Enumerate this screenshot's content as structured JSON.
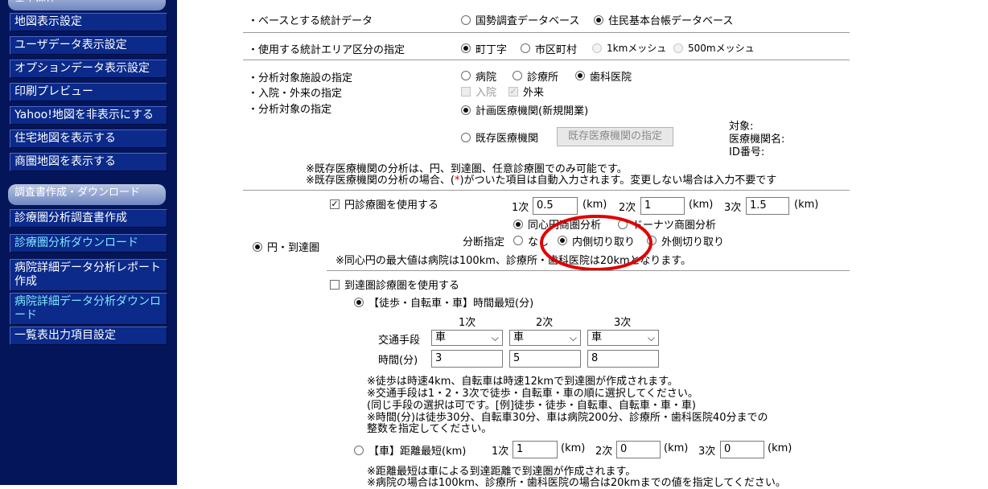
{
  "sidebar": {
    "section1": "基本操作",
    "items1": [
      "地図表示設定",
      "ユーザデータ表示設定",
      "オプションデータ表示設定",
      "印刷プレビュー",
      "Yahoo!地図を非表示にする",
      "住宅地図を表示する",
      "商圏地図を表示する"
    ],
    "section2": "調査書作成・ダウンロード",
    "items2": [
      "診療圏分析調査書作成",
      "診療圏分析ダウンロード",
      "病院詳細データ分析レポート作成",
      "病院詳細データ分析ダウンロード",
      "一覧表出力項目設定"
    ]
  },
  "base": {
    "label": "・ベースとする統計データ",
    "opt1": "国勢調査データベース",
    "opt2": "住民基本台帳データベース"
  },
  "area": {
    "label": "・使用する統計エリア区分の指定",
    "opt1": "町丁字",
    "opt2": "市区町村",
    "opt3": "1kmメッシュ",
    "opt4": "500mメッシュ"
  },
  "facility": {
    "label1": "・分析対象施設の指定",
    "label2": "・入院・外来の指定",
    "label3": "・分析対象の指定",
    "opt_hospital": "病院",
    "opt_clinic": "診療所",
    "opt_dental": "歯科医院",
    "inpatient": "入院",
    "outpatient": "外来",
    "planned": "計画医療機関(新規開業)",
    "existing": "既存医療機関",
    "existing_button": "既存医療機関の指定",
    "target": "対象:",
    "name": "医療機関名:",
    "id": "ID番号:",
    "note1": "※既存医療機関の分析は、円、到達圏、任意診療圏でのみ可能です。",
    "note2_a": "※既存医療機関の分析の場合、(",
    "note2_star": "*",
    "note2_b": ")がついた項目は自動入力されます。変更しない場合は入力不要です"
  },
  "circle": {
    "mode_label": "円・到達圏",
    "use_circle": "円診療圏を使用する",
    "r1_label": "1次",
    "r1": "0.5",
    "r2_label": "2次",
    "r2": "1",
    "r3_label": "3次",
    "r3": "1.5",
    "unit": "(km)",
    "concentric": "同心円商圏分析",
    "donut": "ドーナツ商圏分析",
    "cut_label": "分断指定",
    "cut_none": "なし",
    "cut_inner": "内側切り取り",
    "cut_outer": "外側切り取り",
    "note": "※同心円の最大値は病院は100km、診療所・歯科医院は20kmとなります。"
  },
  "reach": {
    "use_reach": "到達圏診療圏を使用する",
    "time_opt": "【徒歩・自転車・車】時間最短(分)",
    "col1": "1次",
    "col2": "2次",
    "col3": "3次",
    "means_label": "交通手段",
    "means": [
      "車",
      "車",
      "車"
    ],
    "time_label": "時間(分)",
    "times": [
      "3",
      "5",
      "8"
    ],
    "notes": [
      "※徒歩は時速4km、自転車は時速12kmで到達圏が作成されます。",
      "※交通手段は1・2・3次で徒歩・自転車・車の順に選択してください。",
      "(同じ手段の選択は可です。[例]徒歩・徒歩・自転車、自転車・車・車)",
      "※時間(分)は徒歩30分、自転車30分、車は病院200分、診療所・歯科医院40分までの",
      "整数を指定してください。"
    ],
    "dist_opt": "【車】距離最短(km)",
    "d1_label": "1次",
    "d1": "1",
    "d2_label": "2次",
    "d2": "0",
    "d3_label": "3次",
    "d3": "0",
    "unit": "(km)",
    "dist_note1": "※距離最短は車による到達距離で到達圏が作成されます。",
    "dist_note2": "※病院の場合は100km、診療所・歯科医院の場合は20kmまでの値を指定してください。"
  },
  "colors": {
    "sidebar_bg": "#04155a",
    "highlight_ring": "#e00000"
  }
}
